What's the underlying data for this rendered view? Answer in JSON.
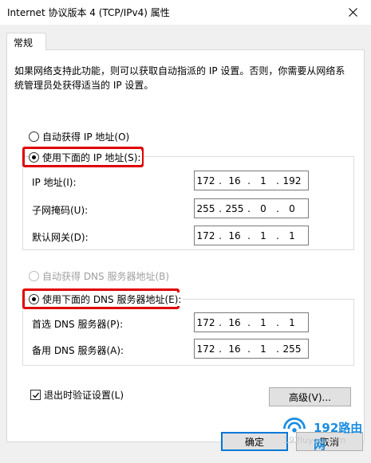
{
  "window": {
    "title": "Internet 协议版本 4 (TCP/IPv4) 属性"
  },
  "tabs": [
    {
      "label": "常规"
    }
  ],
  "description": "如果网络支持此功能，则可以获取自动指派的 IP 设置。否则，你需要从网络系统管理员处获得适当的 IP 设置。",
  "ip_section": {
    "auto_label": "自动获得 IP 地址(O)",
    "manual_label": "使用下面的 IP 地址(S):",
    "manual_selected": true,
    "fields": [
      {
        "label": "IP 地址(I):",
        "octets": [
          "172",
          "16",
          "1",
          "192"
        ]
      },
      {
        "label": "子网掩码(U):",
        "octets": [
          "255",
          "255",
          "0",
          "0"
        ]
      },
      {
        "label": "默认网关(D):",
        "octets": [
          "172",
          "16",
          "1",
          "1"
        ]
      }
    ]
  },
  "dns_section": {
    "auto_label": "自动获得 DNS 服务器地址(B)",
    "auto_disabled": true,
    "manual_label": "使用下面的 DNS 服务器地址(E):",
    "manual_selected": true,
    "fields": [
      {
        "label": "首选 DNS 服务器(P):",
        "octets": [
          "172",
          "16",
          "1",
          "1"
        ]
      },
      {
        "label": "备用 DNS 服务器(A):",
        "octets": [
          "172",
          "16",
          "1",
          "255"
        ]
      }
    ]
  },
  "validate_checkbox": {
    "label": "退出时验证设置(L)",
    "checked": true
  },
  "buttons": {
    "advanced": "高级(V)...",
    "ok": "确定",
    "cancel": "取消"
  },
  "watermark": {
    "brand": "192路由网",
    "url": "192luyou.com"
  },
  "colors": {
    "highlight": "#e00000",
    "dialog_bg": "#f0f0f0",
    "default_button_border": "#0078d7",
    "watermark_blue": "#1a8de0"
  }
}
